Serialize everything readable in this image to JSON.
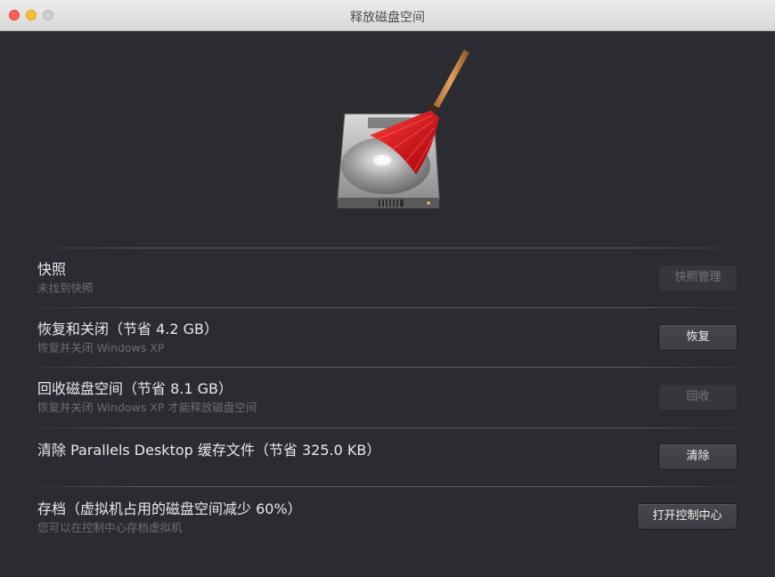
{
  "window": {
    "title": "释放磁盘空间"
  },
  "sections": [
    {
      "title": "快照",
      "subtitle": "未找到快照",
      "button": "快照管理",
      "button_enabled": false
    },
    {
      "title": "恢复和关闭（节省 4.2 GB）",
      "subtitle": "恢复并关闭 Windows XP",
      "button": "恢复",
      "button_enabled": true
    },
    {
      "title": "回收磁盘空间（节省 8.1 GB）",
      "subtitle": "恢复并关闭 Windows XP 才能释放磁盘空间",
      "button": "回收",
      "button_enabled": false
    },
    {
      "title": "清除 Parallels Desktop 缓存文件（节省 325.0 KB）",
      "button": "清除",
      "button_enabled": true
    },
    {
      "title": "存档（虚拟机占用的磁盘空间减少 60%）",
      "subtitle": "您可以在控制中心存档虚拟机",
      "button": "打开控制中心",
      "button_enabled": true
    }
  ],
  "icons": {
    "hero": "disk-cleanup-broom-icon"
  },
  "colors": {
    "background": "#2b2c31",
    "broom": "#d3141d"
  }
}
